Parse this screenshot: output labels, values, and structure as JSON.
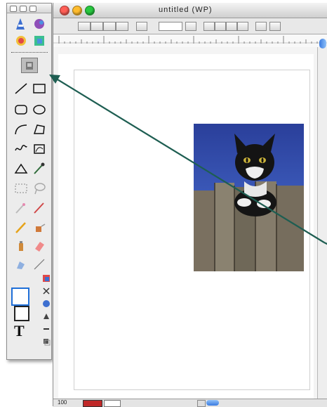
{
  "window": {
    "title": "untitled (WP)"
  },
  "status": {
    "zoom": "100"
  },
  "palette": {
    "tools": [
      {
        "name": "pointer-tool"
      },
      {
        "name": "color-tool"
      },
      {
        "name": "text-wrap-tool"
      },
      {
        "name": "picture-tool"
      },
      {
        "name": "stamp-tool"
      },
      {
        "name": "line-tool"
      },
      {
        "name": "rectangle-tool"
      },
      {
        "name": "rounded-rectangle-tool"
      },
      {
        "name": "oval-tool"
      },
      {
        "name": "arc-tool"
      },
      {
        "name": "polygon-tool"
      },
      {
        "name": "freehand-tool"
      },
      {
        "name": "bezier-tool"
      },
      {
        "name": "triangle-tool"
      },
      {
        "name": "eyedropper-tool"
      },
      {
        "name": "selection-tool"
      },
      {
        "name": "lasso-tool"
      },
      {
        "name": "wand-tool"
      },
      {
        "name": "pencil-tool"
      },
      {
        "name": "paintbrush-tool"
      },
      {
        "name": "fill-tool"
      },
      {
        "name": "spray-tool"
      },
      {
        "name": "eraser-tool"
      },
      {
        "name": "smudge-tool"
      },
      {
        "name": "line-width-tool"
      }
    ]
  },
  "colors": {
    "accent": "#1e5e52",
    "titlebar": "#d8d8d8",
    "close": "#ff5f57",
    "minimize": "#febc2e",
    "zoom": "#28c840"
  }
}
